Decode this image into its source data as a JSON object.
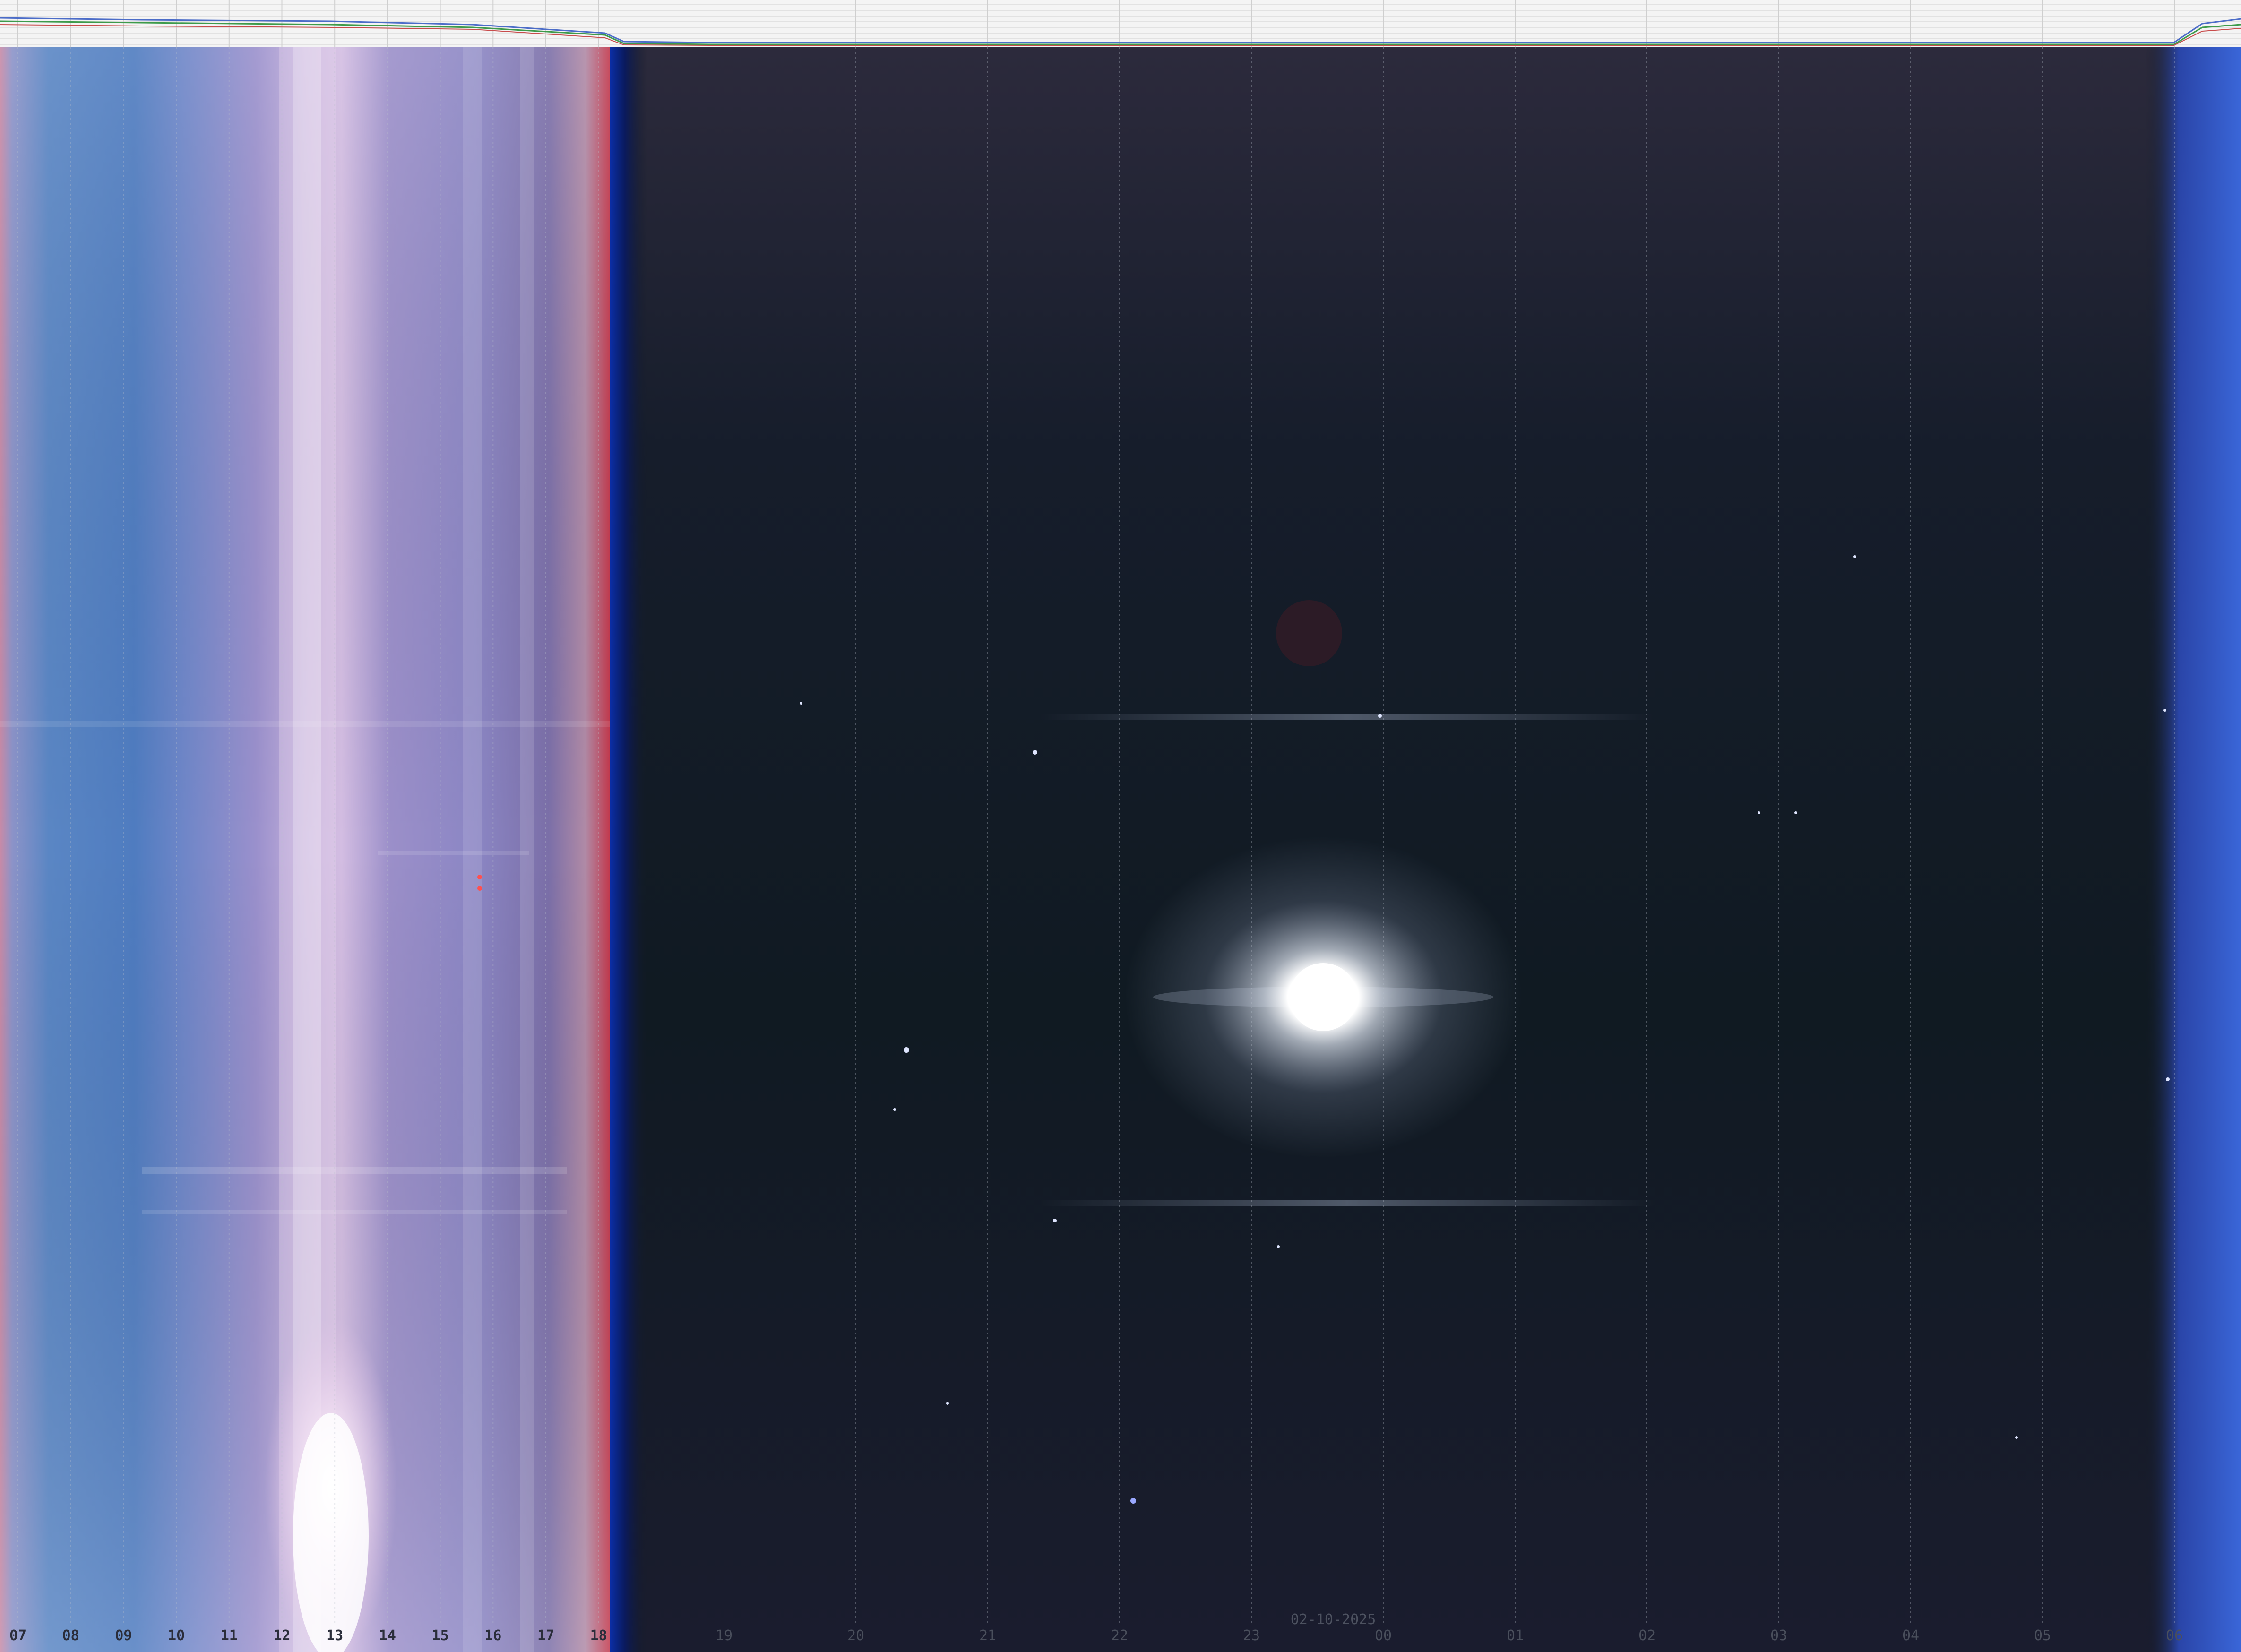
{
  "keogram": {
    "date": "02-10-2025",
    "hour_labels": [
      "07",
      "08",
      "09",
      "10",
      "11",
      "12",
      "13",
      "14",
      "15",
      "16",
      "17",
      "18",
      "19",
      "20",
      "21",
      "22",
      "23",
      "00",
      "01",
      "02",
      "03",
      "04",
      "05",
      "06"
    ]
  },
  "colors": {
    "day_sky": "#6f86c4",
    "night_sky": "#131a26",
    "moon": "#ffffff",
    "dawn_edge": "#2f55c9",
    "chart_background": "#f4f4f4"
  }
}
